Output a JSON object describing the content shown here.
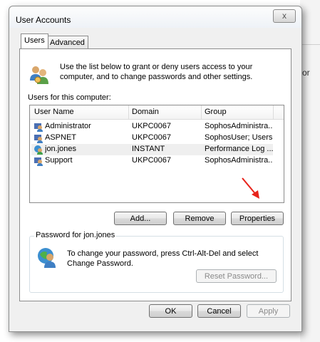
{
  "backdrop": {
    "edge_text": "or"
  },
  "window": {
    "title": "User Accounts",
    "close_label": "x"
  },
  "tabs": [
    {
      "label": "Users",
      "active": true
    },
    {
      "label": "Advanced",
      "active": false
    }
  ],
  "users_tab": {
    "intro": "Use the list below to grant or deny users access to your computer, and to change passwords and other settings.",
    "list_label": "Users for this computer:",
    "columns": [
      "User Name",
      "Domain",
      "Group"
    ],
    "rows": [
      {
        "name": "Administrator",
        "domain": "UKPC0067",
        "group": "SophosAdministra...",
        "icon": "admin-user-icon"
      },
      {
        "name": "ASPNET",
        "domain": "UKPC0067",
        "group": "SophosUser; Users",
        "icon": "user-icon"
      },
      {
        "name": "jon.jones",
        "domain": "INSTANT",
        "group": "Performance Log ...",
        "icon": "domain-user-icon",
        "selected": true
      },
      {
        "name": "Support",
        "domain": "UKPC0067",
        "group": "SophosAdministra...",
        "icon": "admin-user-icon"
      }
    ],
    "buttons": {
      "add": "Add...",
      "remove": "Remove",
      "properties": "Properties"
    },
    "password_group": {
      "label": "Password for jon.jones",
      "text": "To change your password, press Ctrl-Alt-Del and select Change Password.",
      "reset_button": "Reset Password..."
    }
  },
  "footer": {
    "ok": "OK",
    "cancel": "Cancel",
    "apply": "Apply"
  },
  "colors": {
    "annotation_arrow": "#e8231b",
    "selection": "#efefef"
  }
}
